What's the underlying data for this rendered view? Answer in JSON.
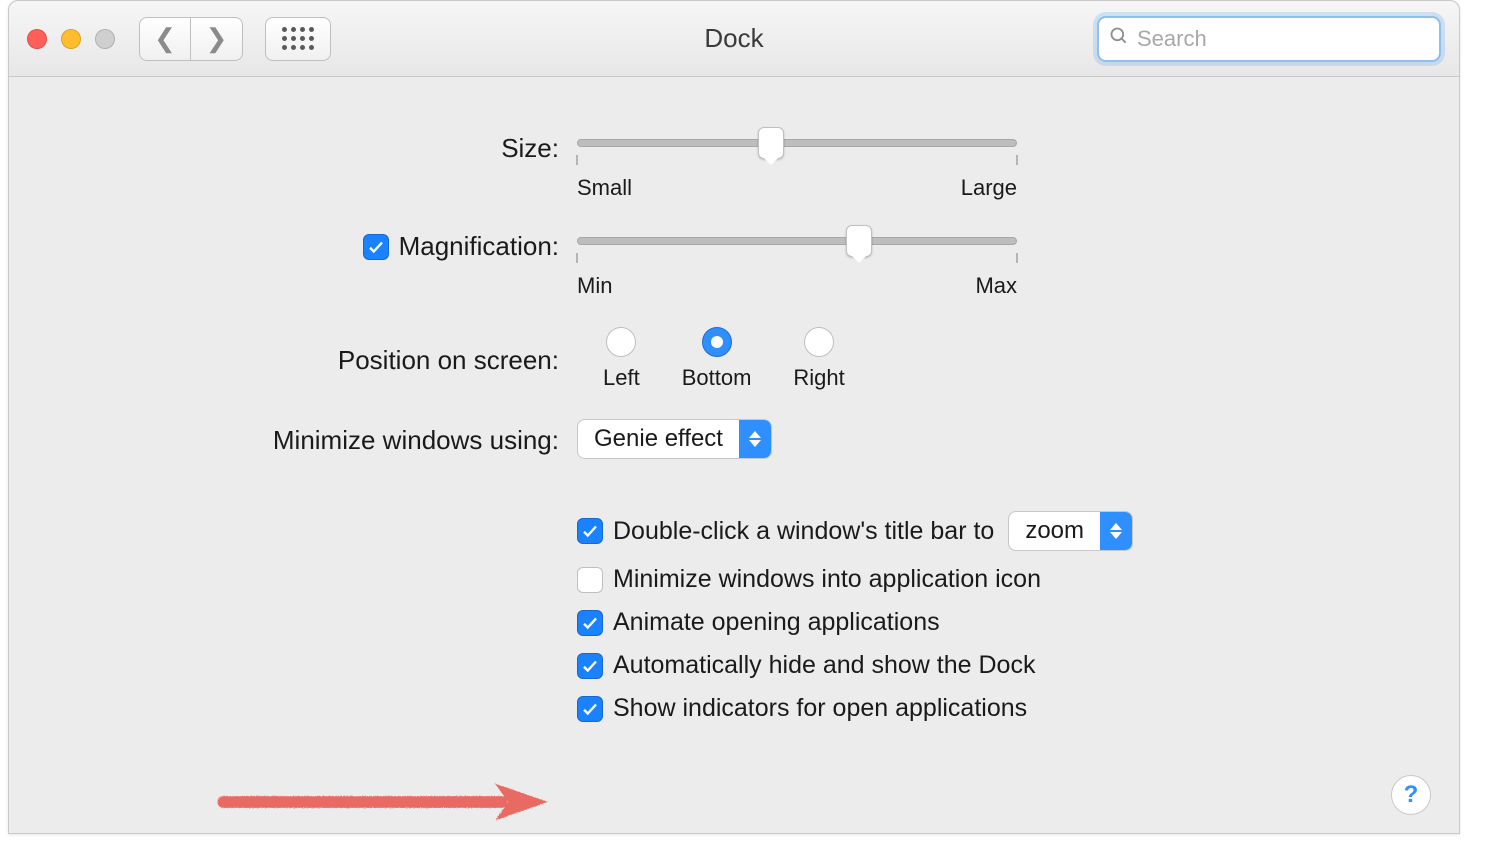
{
  "title": "Dock",
  "search": {
    "placeholder": "Search",
    "value": ""
  },
  "size": {
    "label": "Size:",
    "min_label": "Small",
    "max_label": "Large",
    "value_pct": 44
  },
  "magnification": {
    "checkbox_label": "Magnification:",
    "checked": true,
    "min_label": "Min",
    "max_label": "Max",
    "value_pct": 64
  },
  "position": {
    "label": "Position on screen:",
    "options": [
      "Left",
      "Bottom",
      "Right"
    ],
    "selected_index": 1
  },
  "minimize_using": {
    "label": "Minimize windows using:",
    "selected": "Genie effect"
  },
  "titlebar_action": {
    "prefix": "Double-click a window's title bar to",
    "selected": "zoom",
    "checked": true
  },
  "options": {
    "minimize_into_icon": {
      "label": "Minimize windows into application icon",
      "checked": false
    },
    "animate_opening": {
      "label": "Animate opening applications",
      "checked": true
    },
    "autohide": {
      "label": "Automatically hide and show the Dock",
      "checked": true
    },
    "show_indicators": {
      "label": "Show indicators for open applications",
      "checked": true
    }
  },
  "help_label": "?"
}
